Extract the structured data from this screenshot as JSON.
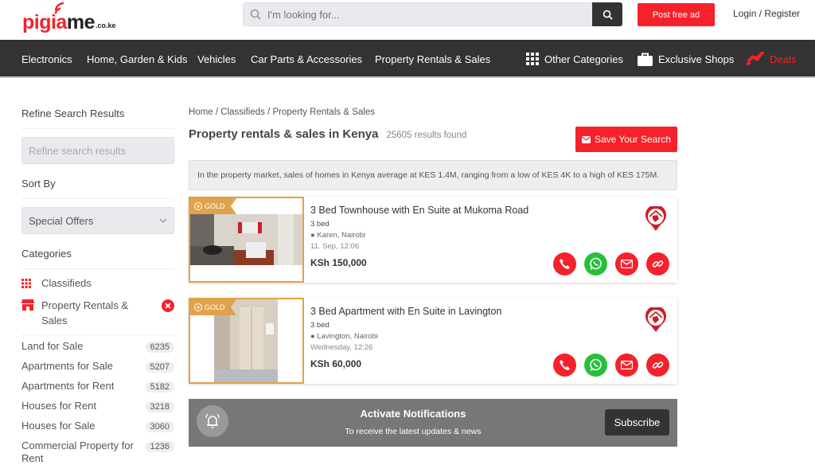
{
  "header": {
    "logo": {
      "part1": "pigia",
      "part2": "me",
      "tld": ".co.ke"
    },
    "search_placeholder": "I'm looking for...",
    "post_ad_label": "Post free ad",
    "login_label": "Login / Register"
  },
  "nav": {
    "items": [
      "Electronics",
      "Home, Garden & Kids",
      "Vehicles",
      "Car Parts & Accessories",
      "Property Rentals & Sales"
    ],
    "other_categories": "Other Categories",
    "exclusive_shops": "Exclusive Shops",
    "deals": "Deals"
  },
  "sidebar": {
    "refine_title": "Refine Search Results",
    "refine_placeholder": "Refine search results",
    "sort_title": "Sort By",
    "sort_value": "Special Offers",
    "categories_title": "Categories",
    "parent_category": "Classifieds",
    "active_category": "Property Rentals & Sales",
    "subcategories": [
      {
        "label": "Land for Sale",
        "count": "6235"
      },
      {
        "label": "Apartments for Sale",
        "count": "5207"
      },
      {
        "label": "Apartments for Rent",
        "count": "5182"
      },
      {
        "label": "Houses for Rent",
        "count": "3218"
      },
      {
        "label": "Houses for Sale",
        "count": "3060"
      },
      {
        "label": "Commercial Property for Rent",
        "count": "1236"
      }
    ]
  },
  "main": {
    "breadcrumb": [
      "Home",
      "Classifieds",
      "Property Rentals & Sales"
    ],
    "title": "Property rentals & sales in Kenya",
    "results_count": "25605 results found",
    "save_search_label": "Save Your Search",
    "info_text": "In the property market, sales of homes in Kenya average at KES 1.4M, ranging from a low of KES 4K to a high of KES 175M.",
    "listings": [
      {
        "badge": "GOLD",
        "title": "3 Bed Townhouse with En Suite at Mukoma Road",
        "beds": "3 bed",
        "location": "Karen, Nairobi",
        "date": "11. Sep, 12:06",
        "price": "KSh 150,000"
      },
      {
        "badge": "GOLD",
        "title": "3 Bed Apartment with En Suite in Lavington",
        "beds": "3 bed",
        "location": "Lavington, Nairobi",
        "date": "Wednesday, 12:26",
        "price": "KSh 60,000"
      }
    ]
  },
  "notification": {
    "title": "Activate Notifications",
    "subtitle": "To receive the latest updates & news",
    "button": "Subscribe"
  },
  "colors": {
    "brand_red": "#f5212b",
    "gold": "#e0a24a",
    "whatsapp_green": "#25c03a",
    "nav_bg": "#333333"
  }
}
